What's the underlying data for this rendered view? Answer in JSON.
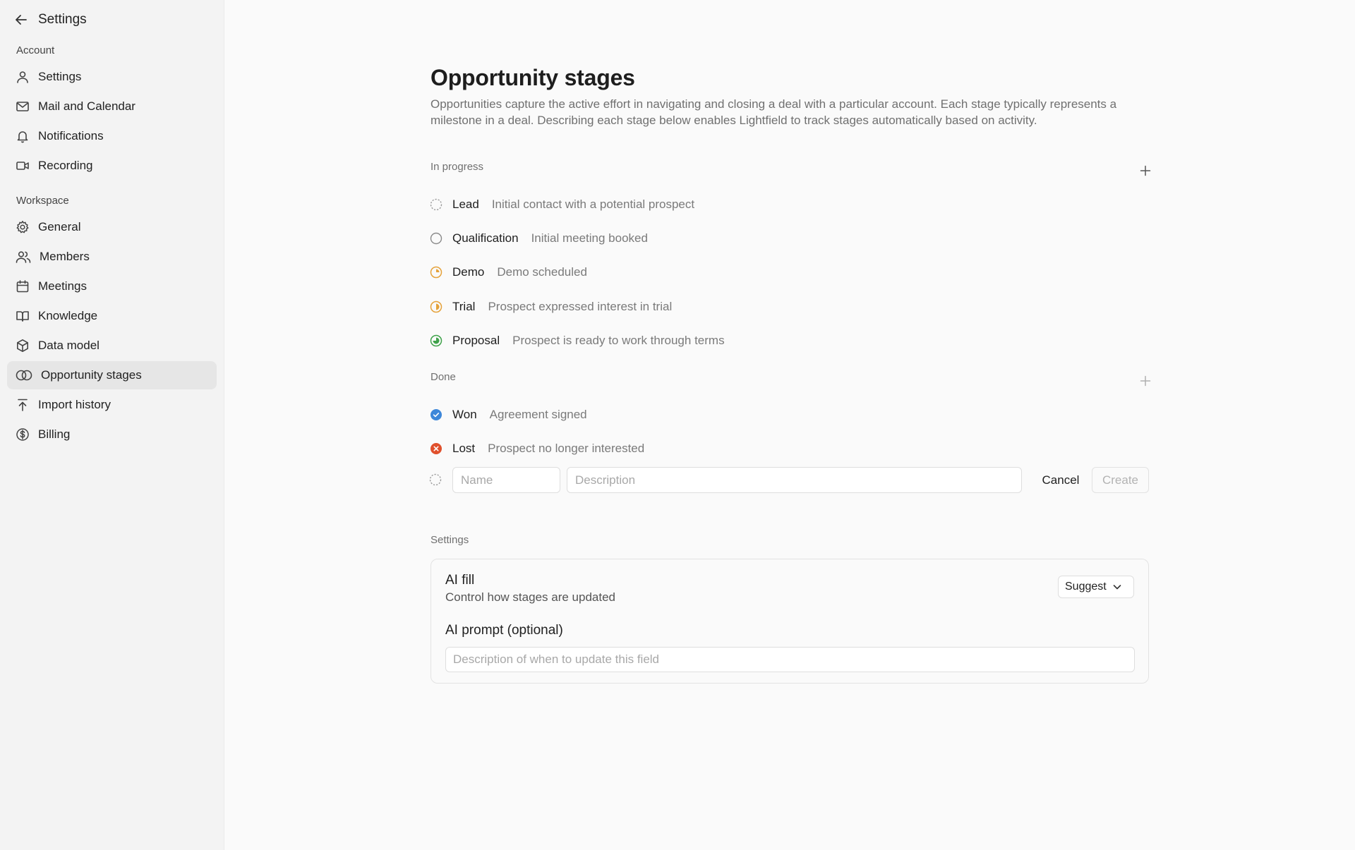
{
  "sidebar": {
    "back_title": "Settings",
    "sections": {
      "account": "Account",
      "workspace": "Workspace"
    },
    "account_items": [
      {
        "label": "Settings",
        "icon": "user-icon"
      },
      {
        "label": "Mail and Calendar",
        "icon": "mail-icon"
      },
      {
        "label": "Notifications",
        "icon": "bell-icon"
      },
      {
        "label": "Recording",
        "icon": "video-icon"
      }
    ],
    "workspace_items": [
      {
        "label": "General",
        "icon": "gear-icon"
      },
      {
        "label": "Members",
        "icon": "users-icon"
      },
      {
        "label": "Meetings",
        "icon": "calendar-icon"
      },
      {
        "label": "Knowledge",
        "icon": "book-icon"
      },
      {
        "label": "Data model",
        "icon": "cube-icon"
      },
      {
        "label": "Opportunity stages",
        "icon": "overlapping-circles-icon",
        "active": true
      },
      {
        "label": "Import history",
        "icon": "upload-icon"
      },
      {
        "label": "Billing",
        "icon": "dollar-icon"
      }
    ]
  },
  "page": {
    "title": "Opportunity stages",
    "description": "Opportunities capture the active effort in navigating and closing a deal with a particular account. Each stage typically represents a milestone in a deal. Describing each stage below enables Lightfield to track stages automatically based on activity."
  },
  "groups": {
    "in_progress": {
      "label": "In progress",
      "stages": [
        {
          "name": "Lead",
          "description": "Initial contact with a potential prospect",
          "icon": "dashed-circle-icon"
        },
        {
          "name": "Qualification",
          "description": "Initial meeting booked",
          "icon": "empty-circle-icon"
        },
        {
          "name": "Demo",
          "description": "Demo scheduled",
          "icon": "quarter-circle-icon",
          "color": "#e5a23a"
        },
        {
          "name": "Trial",
          "description": "Prospect expressed interest in trial",
          "icon": "half-circle-icon",
          "color": "#e5a23a"
        },
        {
          "name": "Proposal",
          "description": "Prospect is ready to work through terms",
          "icon": "three-quarter-circle-icon",
          "color": "#3fa24a"
        }
      ]
    },
    "done": {
      "label": "Done",
      "stages": [
        {
          "name": "Won",
          "description": "Agreement signed",
          "icon": "check-circle-icon",
          "color": "#3d87d9"
        },
        {
          "name": "Lost",
          "description": "Prospect no longer interested",
          "icon": "x-circle-icon",
          "color": "#e0502c"
        }
      ]
    }
  },
  "new_stage": {
    "name_placeholder": "Name",
    "description_placeholder": "Description",
    "cancel_label": "Cancel",
    "create_label": "Create"
  },
  "settings": {
    "label": "Settings",
    "ai_fill_title": "AI fill",
    "ai_fill_subtitle": "Control how stages are updated",
    "dropdown_value": "Suggest",
    "prompt_title": "AI prompt (optional)",
    "prompt_placeholder": "Description of when to update this field"
  }
}
